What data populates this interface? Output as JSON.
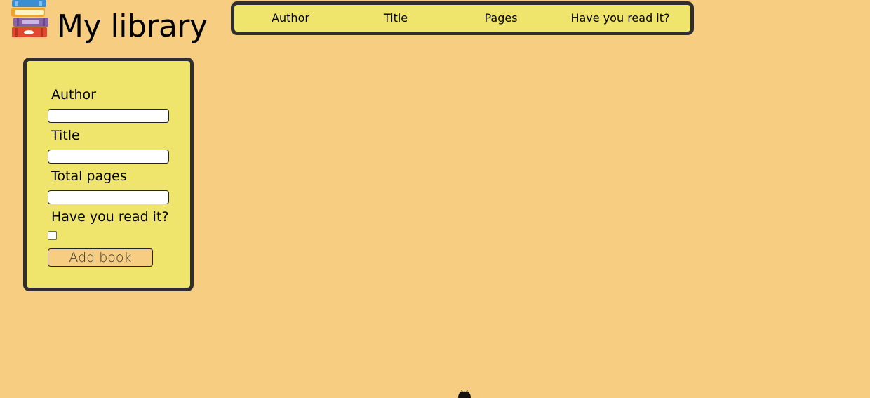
{
  "header": {
    "logo_icon": "stacked-books-icon",
    "title": "My library"
  },
  "table": {
    "columns": [
      "Author",
      "Title",
      "Pages",
      "Have you read it?"
    ]
  },
  "form": {
    "author_label": "Author",
    "author_value": "",
    "title_label": "Title",
    "title_value": "",
    "pages_label": "Total pages",
    "pages_value": "",
    "read_label": "Have you read it?",
    "read_checked": false,
    "add_button_label": "Add book"
  },
  "footer": {
    "github_icon": "github-icon"
  },
  "colors": {
    "background": "#f7cd82",
    "panel": "#efe56c",
    "border": "#2e2e2e"
  }
}
